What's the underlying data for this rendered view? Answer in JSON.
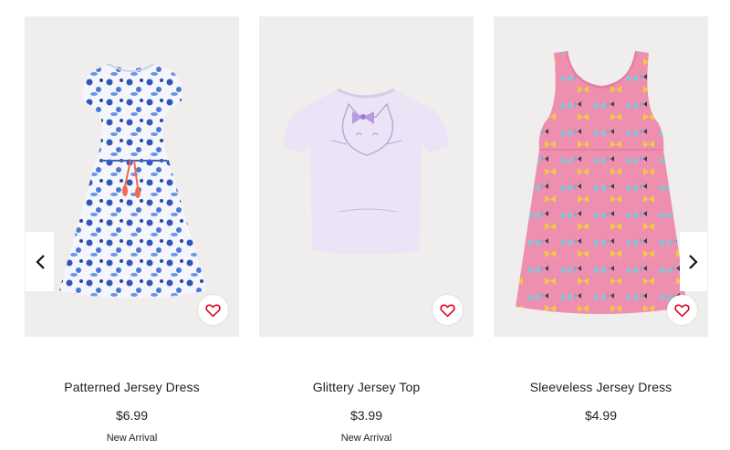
{
  "products": [
    {
      "name": "Patterned Jersey Dress",
      "price": "$6.99",
      "badge": "New Arrival",
      "image": "blue-floral-dress"
    },
    {
      "name": "Glittery Jersey Top",
      "price": "$3.99",
      "badge": "New Arrival",
      "image": "lavender-cat-top"
    },
    {
      "name": "Sleeveless Jersey Dress",
      "price": "$4.99",
      "badge": "",
      "image": "pink-butterfly-dress"
    }
  ],
  "icons": {
    "favorite": "heart-icon",
    "prev": "chevron-left-icon",
    "next": "chevron-right-icon"
  },
  "colors": {
    "accent": "#d6001c",
    "text": "#222222",
    "image_bg": "#efeeec"
  }
}
